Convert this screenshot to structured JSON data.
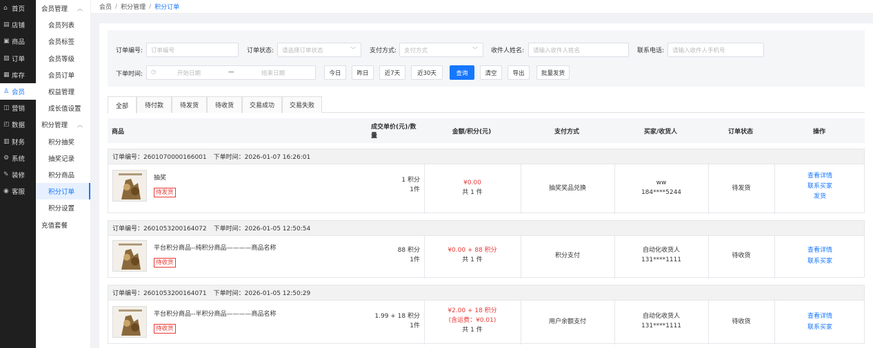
{
  "nav1": [
    {
      "icon": "⌂",
      "label": "首页",
      "iconName": "home-icon"
    },
    {
      "icon": "▤",
      "label": "店铺",
      "iconName": "store-icon"
    },
    {
      "icon": "▣",
      "label": "商品",
      "iconName": "goods-icon"
    },
    {
      "icon": "▧",
      "label": "订单",
      "iconName": "order-icon"
    },
    {
      "icon": "▦",
      "label": "库存",
      "iconName": "stock-icon"
    },
    {
      "icon": "♙",
      "label": "会员",
      "iconName": "member-icon"
    },
    {
      "icon": "◫",
      "label": "营销",
      "iconName": "marketing-icon"
    },
    {
      "icon": "◰",
      "label": "数据",
      "iconName": "data-icon"
    },
    {
      "icon": "▥",
      "label": "财务",
      "iconName": "finance-icon"
    },
    {
      "icon": "⚙",
      "label": "系统",
      "iconName": "system-icon"
    },
    {
      "icon": "✎",
      "label": "装修",
      "iconName": "decorate-icon"
    },
    {
      "icon": "◉",
      "label": "客服",
      "iconName": "service-icon"
    }
  ],
  "nav2": [
    {
      "label": "会员管理",
      "type": "grp"
    },
    {
      "label": "会员列表",
      "type": "sub"
    },
    {
      "label": "会员标签",
      "type": "sub"
    },
    {
      "label": "会员等级",
      "type": "sub"
    },
    {
      "label": "会员订单",
      "type": "sub"
    },
    {
      "label": "权益管理",
      "type": "sub"
    },
    {
      "label": "成长值设置",
      "type": "sub"
    },
    {
      "label": "积分管理",
      "type": "grp"
    },
    {
      "label": "积分抽奖",
      "type": "sub"
    },
    {
      "label": "抽奖记录",
      "type": "sub"
    },
    {
      "label": "积分商品",
      "type": "sub"
    },
    {
      "label": "积分订单",
      "type": "sub"
    },
    {
      "label": "积分设置",
      "type": "sub"
    },
    {
      "label": "充值套餐",
      "type": "grp"
    }
  ],
  "breadcrumb": {
    "a": "会员",
    "b": "积分管理",
    "c": "积分订单",
    "sep": "/"
  },
  "filters": {
    "order_no_label": "订单编号:",
    "order_no_ph": "订单编号",
    "status_label": "订单状态:",
    "status_ph": "请选择订单状态",
    "pay_label": "支付方式:",
    "pay_ph": "支付方式",
    "receiver_label": "收件人姓名:",
    "receiver_ph": "请输入收件人姓名",
    "phone_label": "联系电话:",
    "phone_ph": "请输入收件人手机号",
    "time_label": "下单时间:",
    "start_ph": "开始日期",
    "dash": "—",
    "end_ph": "结束日期",
    "today": "今日",
    "yesterday": "昨日",
    "d7": "近7天",
    "d30": "近30天",
    "query": "查询",
    "clear": "清空",
    "export": "导出",
    "batch": "批量发货"
  },
  "tabs": [
    "全部",
    "待付款",
    "待发货",
    "待收货",
    "交易成功",
    "交易失败"
  ],
  "columns": {
    "goods": "商品",
    "price": "成交单价(元)/数量",
    "amount": "金额/积分(元)",
    "pay": "支付方式",
    "buyer": "买家/收货人",
    "status": "订单状态",
    "op": "操作"
  },
  "orders": [
    {
      "no": "订单编号：2601070000166001",
      "time": "下单时间：2026-01-07 16:26:01",
      "name": "抽奖",
      "tag": "待发货",
      "price": "1 积分",
      "qty": "1件",
      "amount": "¥0.00",
      "extra": "",
      "count": "共 1 件",
      "pay": "抽奖奖品兑换",
      "buyer": "ww",
      "phone": "184****5244",
      "status": "待发货",
      "ops": [
        "查看详情",
        "联系买家",
        "发货"
      ]
    },
    {
      "no": "订单编号：2601053200164072",
      "time": "下单时间：2026-01-05 12:50:54",
      "name": "平台积分商品--纯积分商品————商品名称",
      "tag": "待收货",
      "price": "88 积分",
      "qty": "1件",
      "amount": "¥0.00 + 88 积分",
      "extra": "",
      "count": "共 1 件",
      "pay": "积分支付",
      "buyer": "自动化收货人",
      "phone": "131****1111",
      "status": "待收货",
      "ops": [
        "查看详情",
        "联系买家"
      ]
    },
    {
      "no": "订单编号：2601053200164071",
      "time": "下单时间：2026-01-05 12:50:29",
      "name": "平台积分商品--半积分商品————商品名称",
      "tag": "待收货",
      "price": "1.99 + 18 积分",
      "qty": "1件",
      "amount": "¥2.00 + 18 积分",
      "extra": "(含运费：¥0.01)",
      "count": "共 1 件",
      "pay": "用户余额支付",
      "buyer": "自动化收货人",
      "phone": "131****1111",
      "status": "待收货",
      "ops": [
        "查看详情",
        "联系买家"
      ]
    }
  ]
}
